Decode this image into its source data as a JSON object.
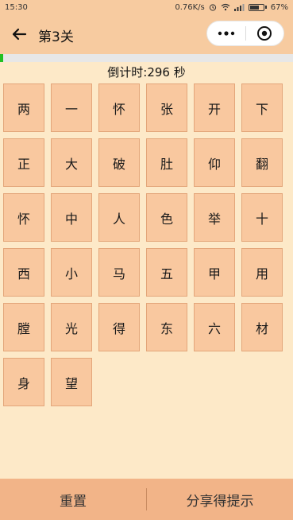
{
  "status_bar": {
    "time": "15:30",
    "network_speed": "0.76K/s",
    "battery_percent": "67%",
    "battery_level": 0.67
  },
  "header": {
    "title": "第3关"
  },
  "progress": {
    "fraction": 0.01
  },
  "countdown": {
    "text": "倒计时:296 秒"
  },
  "grid": {
    "cells": [
      "两",
      "一",
      "怀",
      "张",
      "开",
      "下",
      "正",
      "大",
      "破",
      "肚",
      "仰",
      "翻",
      "怀",
      "中",
      "人",
      "色",
      "举",
      "十",
      "西",
      "小",
      "马",
      "五",
      "甲",
      "用",
      "膛",
      "光",
      "得",
      "东",
      "六",
      "材",
      "身",
      "望"
    ]
  },
  "footer": {
    "reset_label": "重置",
    "share_label": "分享得提示"
  },
  "colors": {
    "background": "#fde9c8",
    "bar": "#f7cba0",
    "cell": "#f9c89f",
    "progress": "#22c022",
    "footer": "#f2b488"
  }
}
